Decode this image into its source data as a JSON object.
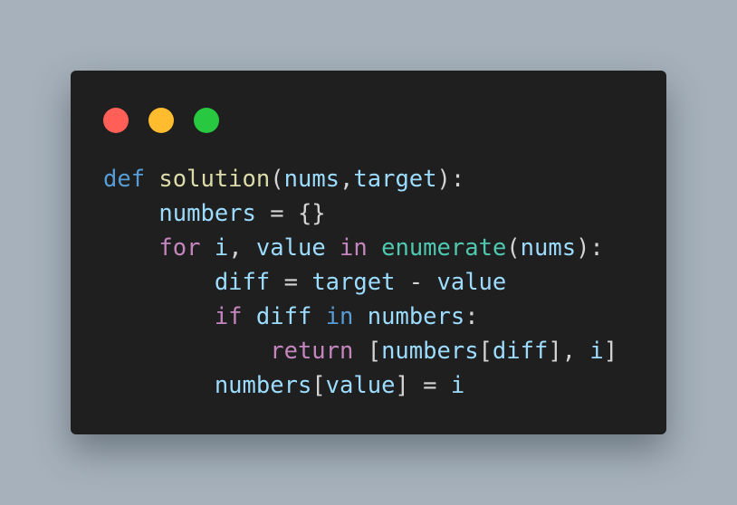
{
  "window_controls": [
    {
      "name": "close",
      "color": "#ff5f57"
    },
    {
      "name": "minimize",
      "color": "#febc2e"
    },
    {
      "name": "maximize",
      "color": "#28c840"
    }
  ],
  "colors": {
    "background": "#a6b1bb",
    "editor": "#1f1f1f",
    "keyword_blue": "#569cd6",
    "keyword_purple": "#c586c0",
    "function": "#dcdcaa",
    "builtin": "#4ec9b0",
    "variable": "#9cdcfe",
    "plain": "#d4d4d4"
  },
  "code_lines": [
    [
      {
        "text": "def",
        "type": "keyword_blue"
      },
      {
        "text": " ",
        "type": "plain"
      },
      {
        "text": "solution",
        "type": "function"
      },
      {
        "text": "(",
        "type": "plain"
      },
      {
        "text": "nums",
        "type": "variable"
      },
      {
        "text": ",",
        "type": "plain"
      },
      {
        "text": "target",
        "type": "variable"
      },
      {
        "text": "):",
        "type": "plain"
      }
    ],
    [
      {
        "text": "    ",
        "type": "plain"
      },
      {
        "text": "numbers",
        "type": "variable"
      },
      {
        "text": " = {}",
        "type": "plain"
      }
    ],
    [
      {
        "text": "    ",
        "type": "plain"
      },
      {
        "text": "for",
        "type": "keyword_purple"
      },
      {
        "text": " ",
        "type": "plain"
      },
      {
        "text": "i",
        "type": "variable"
      },
      {
        "text": ", ",
        "type": "plain"
      },
      {
        "text": "value",
        "type": "variable"
      },
      {
        "text": " ",
        "type": "plain"
      },
      {
        "text": "in",
        "type": "keyword_purple"
      },
      {
        "text": " ",
        "type": "plain"
      },
      {
        "text": "enumerate",
        "type": "builtin"
      },
      {
        "text": "(",
        "type": "plain"
      },
      {
        "text": "nums",
        "type": "variable"
      },
      {
        "text": "):",
        "type": "plain"
      }
    ],
    [
      {
        "text": "        ",
        "type": "plain"
      },
      {
        "text": "diff",
        "type": "variable"
      },
      {
        "text": " = ",
        "type": "plain"
      },
      {
        "text": "target",
        "type": "variable"
      },
      {
        "text": " - ",
        "type": "plain"
      },
      {
        "text": "value",
        "type": "variable"
      }
    ],
    [
      {
        "text": "        ",
        "type": "plain"
      },
      {
        "text": "if",
        "type": "keyword_purple"
      },
      {
        "text": " ",
        "type": "plain"
      },
      {
        "text": "diff",
        "type": "variable"
      },
      {
        "text": " ",
        "type": "plain"
      },
      {
        "text": "in",
        "type": "keyword_blue"
      },
      {
        "text": " ",
        "type": "plain"
      },
      {
        "text": "numbers",
        "type": "variable"
      },
      {
        "text": ":",
        "type": "plain"
      }
    ],
    [
      {
        "text": "            ",
        "type": "plain"
      },
      {
        "text": "return",
        "type": "keyword_purple"
      },
      {
        "text": " [",
        "type": "plain"
      },
      {
        "text": "numbers",
        "type": "variable"
      },
      {
        "text": "[",
        "type": "plain"
      },
      {
        "text": "diff",
        "type": "variable"
      },
      {
        "text": "], ",
        "type": "plain"
      },
      {
        "text": "i",
        "type": "variable"
      },
      {
        "text": "]",
        "type": "plain"
      }
    ],
    [
      {
        "text": "        ",
        "type": "plain"
      },
      {
        "text": "numbers",
        "type": "variable"
      },
      {
        "text": "[",
        "type": "plain"
      },
      {
        "text": "value",
        "type": "variable"
      },
      {
        "text": "] = ",
        "type": "plain"
      },
      {
        "text": "i",
        "type": "variable"
      }
    ]
  ]
}
